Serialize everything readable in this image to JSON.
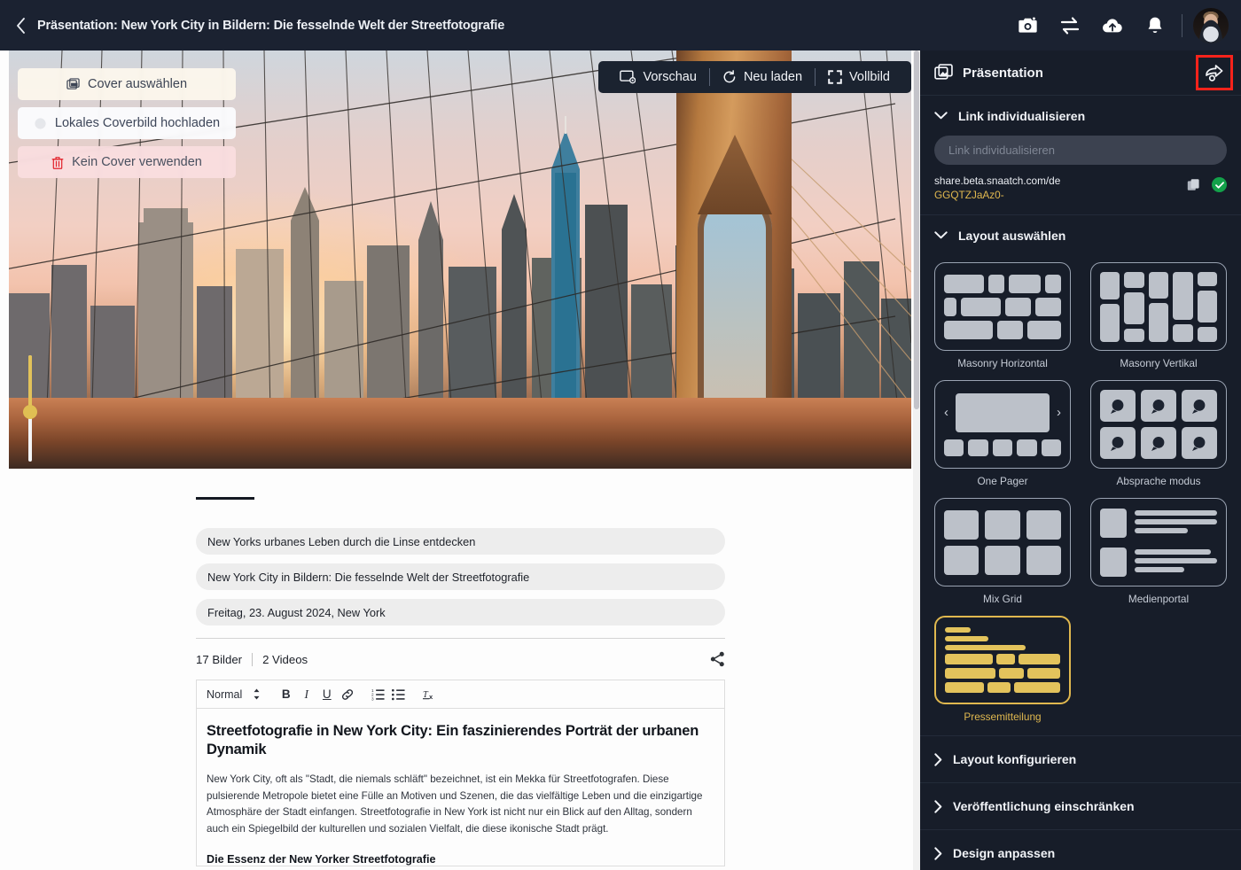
{
  "topbar": {
    "back_icon": "chevron-left-icon",
    "title": "Präsentation: New York City in Bildern: Die fesselnde Welt der Streetfotografie",
    "actions": [
      {
        "name": "camera-icon",
        "label": "Kamera"
      },
      {
        "name": "swap-icon",
        "label": "Wechseln"
      },
      {
        "name": "cloud-upload-icon",
        "label": "Hochladen"
      },
      {
        "name": "bell-icon",
        "label": "Benachrichtigungen"
      }
    ],
    "avatar_label": "Benutzerprofil"
  },
  "cover": {
    "buttons": [
      {
        "label": "Cover auswählen",
        "icon": "image-icon"
      },
      {
        "label": "Lokales Coverbild hochladen",
        "icon": "upload-icon"
      },
      {
        "label": "Kein Cover verwenden",
        "icon": "trash-icon"
      }
    ],
    "toolbar": [
      {
        "label": "Vorschau",
        "icon": "preview-icon"
      },
      {
        "label": "Neu laden",
        "icon": "refresh-icon"
      },
      {
        "label": "Vollbild",
        "icon": "fullscreen-icon"
      }
    ],
    "slider_value": "55"
  },
  "document": {
    "fields": [
      "New Yorks urbanes Leben durch die Linse entdecken",
      "New York City in Bildern: Die fesselnde Welt der Streetfotografie",
      "Freitag, 23. August 2024, New York"
    ],
    "meta": {
      "images": "17 Bilder",
      "videos": "2 Videos",
      "share_icon": "share-icon"
    },
    "editor": {
      "style_select": "Normal",
      "tools": [
        {
          "name": "bold-button",
          "glyph": "B"
        },
        {
          "name": "italic-button",
          "glyph": "I"
        },
        {
          "name": "underline-button",
          "glyph": "U"
        },
        {
          "name": "link-button",
          "glyph": "link-icon"
        },
        {
          "name": "ordered-list-button",
          "glyph": "ordered-list-icon"
        },
        {
          "name": "bullet-list-button",
          "glyph": "bullet-list-icon"
        },
        {
          "name": "clear-format-button",
          "glyph": "Tx"
        }
      ],
      "heading": "Streetfotografie in New York City: Ein faszinierendes Porträt der urbanen Dynamik",
      "paragraph": "New York City, oft als \"Stadt, die niemals schläft\" bezeichnet, ist ein Mekka für Streetfotografen. Diese pulsierende Metropole bietet eine Fülle an Motiven und Szenen, die das vielfältige Leben und die einzigartige Atmosphäre der Stadt einfangen. Streetfotografie in New York ist nicht nur ein Blick auf den Alltag, sondern auch ein Spiegelbild der kulturellen und sozialen Vielfalt, die diese ikonische Stadt prägt.",
      "subheading": "Die Essenz der New Yorker Streetfotografie"
    }
  },
  "sidebar": {
    "title": "Präsentation",
    "header_icon": "image-icon",
    "share_icon": "share-arrow-icon",
    "link_section": {
      "label": "Link individualisieren",
      "input_placeholder": "Link individualisieren",
      "input_value": "",
      "url_base": "share.beta.snaatch.com/de",
      "url_id": "GGQTZJaAz0-",
      "copy_icon": "copy-icon",
      "status_icon": "check-icon",
      "status_color": "#13a14a"
    },
    "layout_section": {
      "label": "Layout auswählen",
      "selected": "Pressemitteilung",
      "accent_color": "#e0b84f",
      "options": [
        {
          "label": "Masonry Horizontal",
          "key": "masonry-horizontal",
          "selected": false
        },
        {
          "label": "Masonry Vertikal",
          "key": "masonry-vertikal",
          "selected": false
        },
        {
          "label": "One Pager",
          "key": "one-pager",
          "selected": false
        },
        {
          "label": "Absprache modus",
          "key": "absprache-modus",
          "selected": false
        },
        {
          "label": "Mix Grid",
          "key": "mix-grid",
          "selected": false
        },
        {
          "label": "Medienportal",
          "key": "medienportal",
          "selected": false
        },
        {
          "label": "Pressemitteilung",
          "key": "pressemitteilung",
          "selected": true
        }
      ]
    },
    "accordion": [
      {
        "label": "Layout konfigurieren"
      },
      {
        "label": "Veröffentlichung einschränken"
      },
      {
        "label": "Design anpassen"
      }
    ]
  }
}
